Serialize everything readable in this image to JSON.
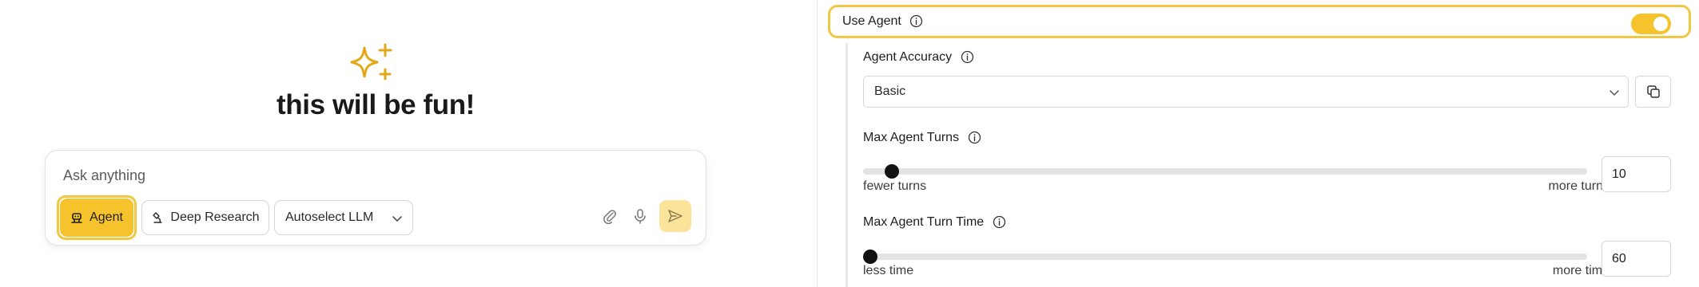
{
  "chat": {
    "headline": "this will be fun!",
    "input_placeholder": "Ask anything",
    "agent_label": "Agent",
    "deep_research_label": "Deep Research",
    "llm_selected": "Autoselect LLM",
    "icons": [
      "sparkle-icon",
      "agent-icon",
      "research-icon",
      "chevron-down-icon",
      "paperclip-icon",
      "microphone-icon",
      "send-icon"
    ]
  },
  "settings": {
    "use_agent": {
      "label": "Use Agent",
      "enabled": true
    },
    "agent_accuracy": {
      "label": "Agent Accuracy",
      "selected": "Basic"
    },
    "max_agent_turns": {
      "label": "Max Agent Turns",
      "value": "10",
      "min_label": "fewer turns",
      "max_label": "more turns",
      "slider_fraction": 0.04
    },
    "max_agent_turn_time": {
      "label": "Max Agent Turn Time",
      "value": "60",
      "min_label": "less time",
      "max_label": "more time",
      "slider_fraction": 0.01
    }
  },
  "colors": {
    "accent": "#f7c32c",
    "accent_ring": "#f0c643",
    "send_button": "#fbe39a"
  }
}
